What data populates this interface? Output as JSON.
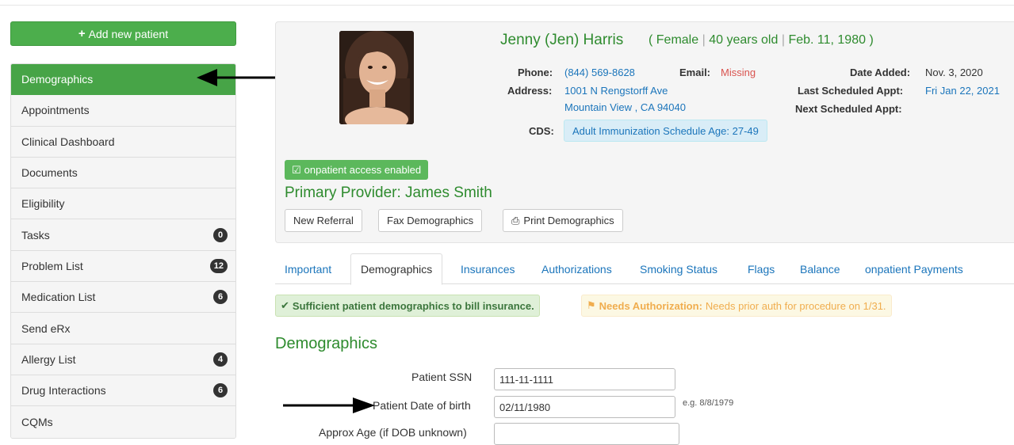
{
  "sidebar": {
    "add_button": "Add new patient",
    "items": [
      {
        "label": "Demographics",
        "badge": null,
        "active": true
      },
      {
        "label": "Appointments",
        "badge": null
      },
      {
        "label": "Clinical Dashboard",
        "badge": null
      },
      {
        "label": "Documents",
        "badge": null
      },
      {
        "label": "Eligibility",
        "badge": null
      },
      {
        "label": "Tasks",
        "badge": "0"
      },
      {
        "label": "Problem List",
        "badge": "12"
      },
      {
        "label": "Medication List",
        "badge": "6"
      },
      {
        "label": "Send eRx",
        "badge": null
      },
      {
        "label": "Allergy List",
        "badge": "4"
      },
      {
        "label": "Drug Interactions",
        "badge": "6"
      },
      {
        "label": "CQMs",
        "badge": null
      }
    ]
  },
  "patient": {
    "name": "Jenny (Jen) Harris",
    "open_paren": "(",
    "gender": "Female",
    "sep": "|",
    "age": "40 years old",
    "dob": "Feb. 11, 1980",
    "close_paren": ")",
    "phone_label": "Phone:",
    "phone": "(844) 569-8628",
    "email_label": "Email:",
    "email": "Missing",
    "address_label": "Address:",
    "address_line1": "1001 N Rengstorff Ave",
    "address_line2": "Mountain View , CA 94040",
    "cds_label": "CDS:",
    "cds": "Adult Immunization Schedule Age: 27-49",
    "date_added_label": "Date Added:",
    "date_added": "Nov. 3, 2020",
    "last_appt_label": "Last Scheduled Appt:",
    "last_appt": "Fri Jan 22, 2021",
    "next_appt_label": "Next Scheduled Appt:"
  },
  "access_badge": "onpatient access enabled",
  "primary_provider": "Primary Provider: James Smith",
  "actions": {
    "new_referral": "New Referral",
    "fax": "Fax Demographics",
    "print": "Print Demographics"
  },
  "tabs": [
    "Important",
    "Demographics",
    "Insurances",
    "Authorizations",
    "Smoking Status",
    "Flags",
    "Balance",
    "onpatient Payments"
  ],
  "alerts": {
    "ok": "Sufficient patient demographics to bill insurance.",
    "warn_title": "Needs Authorization:",
    "warn_text": "Needs prior auth for procedure on 1/31."
  },
  "section_title": "Demographics",
  "form": {
    "ssn_label": "Patient SSN",
    "ssn_value": "111-11-1111",
    "dob_label": "Patient Date of birth",
    "dob_value": "02/11/1980",
    "dob_hint": "e.g. 8/8/1979",
    "approx_label": "Approx Age (if DOB unknown)",
    "approx_value": ""
  },
  "colors": {
    "brand_green": "#47a447",
    "link_blue": "#1b75bb",
    "missing_red": "#d9534f",
    "warn_orange": "#f0ad4e"
  }
}
